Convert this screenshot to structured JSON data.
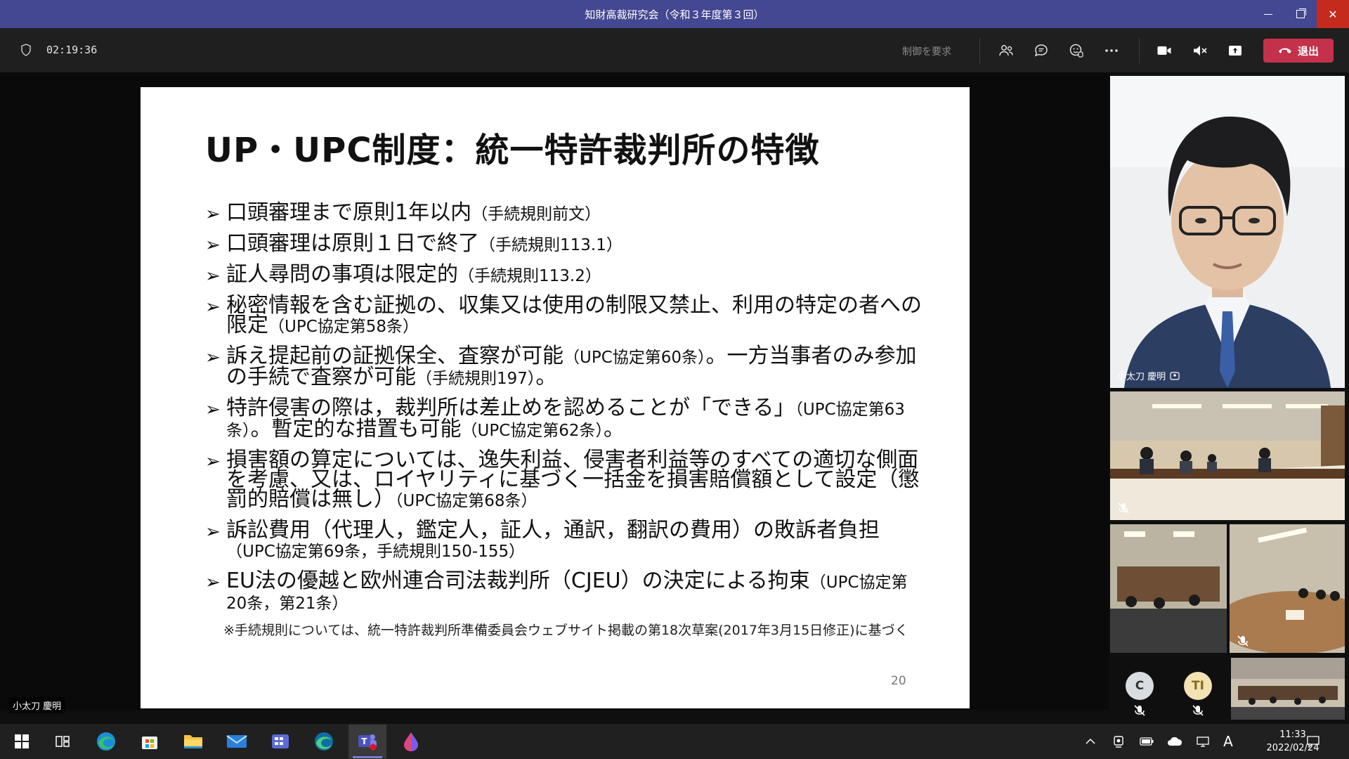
{
  "window": {
    "title": "知財高裁研究会（令和３年度第３回）"
  },
  "toolbar": {
    "timer": "02:19:36",
    "request_control": "制御を要求",
    "leave_label": "退出"
  },
  "slide": {
    "title": "UP・UPC制度：統一特許裁判所の特徴",
    "bullets": [
      {
        "main": "口頭審理まで原則1年以内",
        "ref": "（手続規則前文）"
      },
      {
        "main": "口頭審理は原則１日で終了",
        "ref": "（手続規則113.1）"
      },
      {
        "main": "証人尋問の事項は限定的",
        "ref": "（手続規則113.2）"
      },
      {
        "main": "秘密情報を含む証拠の、収集又は使用の制限又禁止、利用の特定の者への限定",
        "ref": "（UPC協定第58条）"
      },
      {
        "main": "訴え提起前の証拠保全、査察が可能",
        "ref": "（UPC協定第60条）",
        "tail": "。一方当事者のみ参加の手続で査察が可能",
        "ref2": "（手続規則197）",
        "end": "。"
      },
      {
        "main": "特許侵害の際は，裁判所は差止めを認めることが「できる」",
        "ref": "（UPC協定第63条）",
        "tail": "。暫定的な措置も可能",
        "ref2": "（UPC協定第62条）",
        "end": "。"
      },
      {
        "main": "損害額の算定については、逸失利益、侵害者利益等のすべての適切な側面を考慮、又は、ロイヤリティに基づく一括金を損害賠償額として設定（懲罰的賠償は無し）",
        "ref": "（UPC協定第68条）"
      },
      {
        "main": "訴訟費用（代理人，鑑定人，証人，通訳，翻訳の費用）の敗訴者負担",
        "ref": "（UPC協定第69条，手続規則150-155）"
      },
      {
        "main": "EU法の優越と欧州連合司法裁判所（CJEU）の決定による拘束",
        "ref": "（UPC協定第20条，第21条）"
      }
    ],
    "footnote": "※手続規則については、統一特許裁判所準備委員会ウェブサイト掲載の第18次草案(2017年3月15日修正)に基づく",
    "page_number": "20"
  },
  "presenter": {
    "name": "小太刀 慶明"
  },
  "participants": {
    "speaker_name": "小太刀 慶明",
    "avatar_c": "C",
    "avatar_ti": "TI"
  },
  "taskbar": {
    "time": "11:33",
    "date": "2022/02/24",
    "ime": "A"
  },
  "colors": {
    "titlebar": "#444791",
    "leave_button": "#c4314b",
    "avatar_c_bg": "#d8dde2",
    "avatar_ti_bg": "#f3e2b3"
  }
}
